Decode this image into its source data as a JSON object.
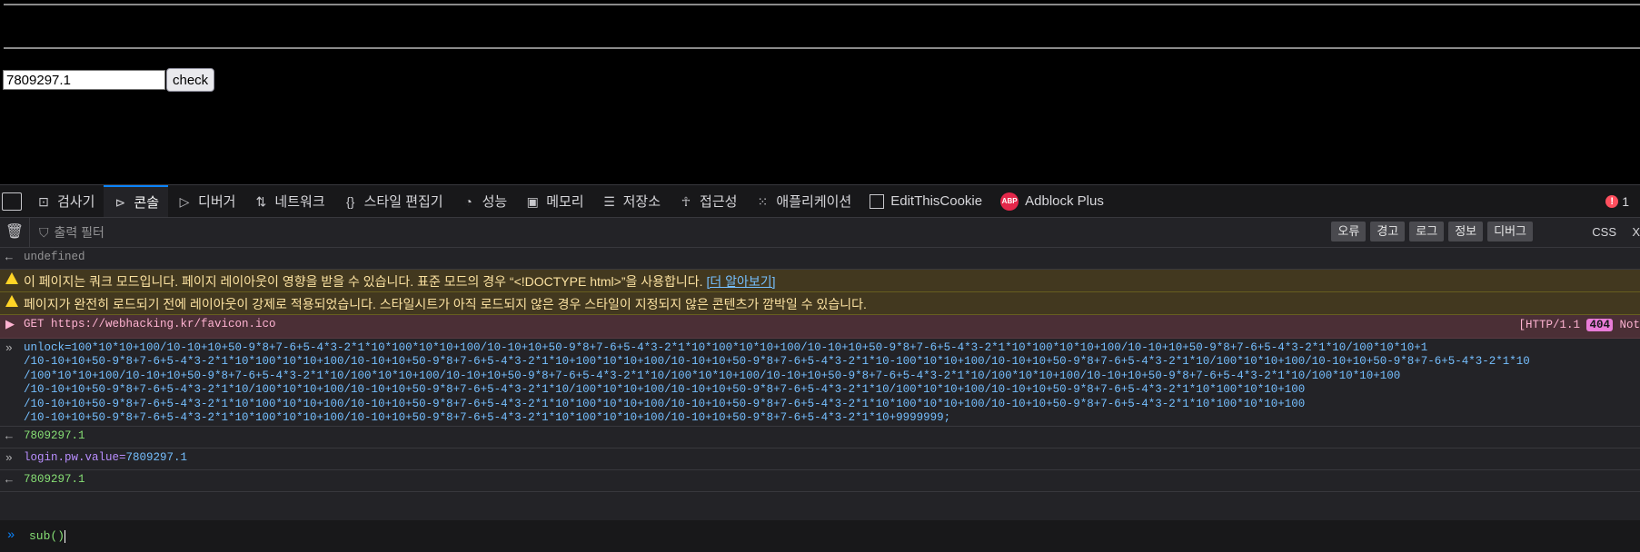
{
  "page": {
    "pw_value": "7809297.1",
    "check_label": "check"
  },
  "devtools": {
    "tabs": [
      {
        "label": "검사기",
        "icon": "inspector-icon"
      },
      {
        "label": "콘솔",
        "icon": "console-icon"
      },
      {
        "label": "디버거",
        "icon": "debugger-icon"
      },
      {
        "label": "네트워크",
        "icon": "network-icon"
      },
      {
        "label": "스타일 편집기",
        "icon": "style-editor-icon"
      },
      {
        "label": "성능",
        "icon": "performance-icon"
      },
      {
        "label": "메모리",
        "icon": "memory-icon"
      },
      {
        "label": "저장소",
        "icon": "storage-icon"
      },
      {
        "label": "접근성",
        "icon": "accessibility-icon"
      },
      {
        "label": "애플리케이션",
        "icon": "application-icon"
      },
      {
        "label": "EditThisCookie",
        "icon": "checkbox-icon"
      },
      {
        "label": "Adblock Plus",
        "icon": "adblock-icon"
      }
    ],
    "active_tab": "콘솔",
    "error_count": "1",
    "filter_placeholder": "출력 필터",
    "levels": [
      "오류",
      "경고",
      "로그",
      "정보",
      "디버그"
    ],
    "css_label": "CSS",
    "x_label": "X"
  },
  "console": {
    "undefined_text": "undefined",
    "warn1_text": "이 페이지는 쿼크 모드입니다. 페이지 레이아웃이 영향을 받을 수 있습니다. 표준 모드의 경우 “<!DOCTYPE html>”을 사용합니다.",
    "warn1_link": "[더 알아보기]",
    "warn2_text": "페이지가 완전히 로드되기 전에 레이아웃이 강제로 적용되었습니다. 스타일시트가 아직 로드되지 않은 경우 스타일이 지정되지 않은 콘텐츠가 깜박일 수 있습니다.",
    "err_text": "GET https://webhacking.kr/favicon.ico",
    "err_status_prefix": "[HTTP/1.1 ",
    "err_status_code": "404",
    "err_status_suffix": " Not",
    "input_lines": [
      "unlock=100*10*10+100/10-10+10+50-9*8+7-6+5-4*3-2*1*10*100*10*10+100/10-10+10+50-9*8+7-6+5-4*3-2*1*10*100*10*10+100/10-10+10+50-9*8+7-6+5-4*3-2*1*10*100*10*10+100/10-10+10+50-9*8+7-6+5-4*3-2*1*10/100*10*10+1",
      "/10-10+10+50-9*8+7-6+5-4*3-2*1*10*100*10*10+100/10-10+10+50-9*8+7-6+5-4*3-2*1*10+100*10*10+100/10-10+10+50-9*8+7-6+5-4*3-2*1*10-100*10*10+100/10-10+10+50-9*8+7-6+5-4*3-2*1*10/100*10*10+100/10-10+10+50-9*8+7-6+5-4*3-2*1*10",
      "/100*10*10+100/10-10+10+50-9*8+7-6+5-4*3-2*1*10/100*10*10+100/10-10+10+50-9*8+7-6+5-4*3-2*1*10/100*10*10+100/10-10+10+50-9*8+7-6+5-4*3-2*1*10/100*10*10+100/10-10+10+50-9*8+7-6+5-4*3-2*1*10/100*10*10+100",
      "/10-10+10+50-9*8+7-6+5-4*3-2*1*10/100*10*10+100/10-10+10+50-9*8+7-6+5-4*3-2*1*10/100*10*10+100/10-10+10+50-9*8+7-6+5-4*3-2*1*10/100*10*10+100/10-10+10+50-9*8+7-6+5-4*3-2*1*10*100*10*10+100",
      "/10-10+10+50-9*8+7-6+5-4*3-2*1*10*100*10*10+100/10-10+10+50-9*8+7-6+5-4*3-2*1*10*100*10*10+100/10-10+10+50-9*8+7-6+5-4*3-2*1*10*100*10*10+100/10-10+10+50-9*8+7-6+5-4*3-2*1*10*100*10*10+100",
      "/10-10+10+50-9*8+7-6+5-4*3-2*1*10*100*10*10+100/10-10+10+50-9*8+7-6+5-4*3-2*1*10*100*10*10+100/10-10+10+50-9*8+7-6+5-4*3-2*1*10+9999999;"
    ],
    "result1": "7809297.1",
    "input2_obj": "login",
    "input2_prop": ".pw.value=",
    "input2_val": "7809297.1",
    "result2": "7809297.1",
    "prompt_text": "sub()"
  }
}
